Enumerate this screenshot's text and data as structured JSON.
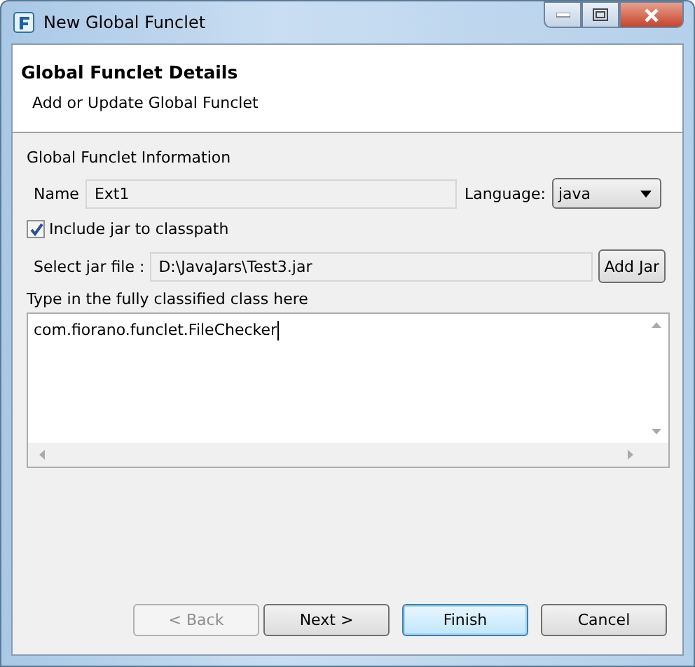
{
  "window": {
    "title": "New Global Funclet"
  },
  "header": {
    "title": "Global Funclet Details",
    "subtitle": "Add or Update Global Funclet"
  },
  "section": {
    "title": "Global Funclet Information"
  },
  "name_field": {
    "label": "Name",
    "value": "Ext1"
  },
  "language": {
    "label": "Language:",
    "value": "java"
  },
  "include_jar": {
    "label": "Include jar to classpath",
    "checked": true
  },
  "jar_file": {
    "label": "Select jar file :",
    "value": "D:\\JavaJars\\Test3.jar",
    "button": "Add Jar"
  },
  "class_area": {
    "label": "Type in the fully classified class here",
    "value": "com.fiorano.funclet.FileChecker"
  },
  "buttons": [
    {
      "label": "< Back",
      "disabled": true,
      "default": false
    },
    {
      "label": "Next >",
      "disabled": false,
      "default": false
    },
    {
      "label": "Finish",
      "disabled": false,
      "default": true
    },
    {
      "label": "Cancel",
      "disabled": false,
      "default": false
    }
  ]
}
